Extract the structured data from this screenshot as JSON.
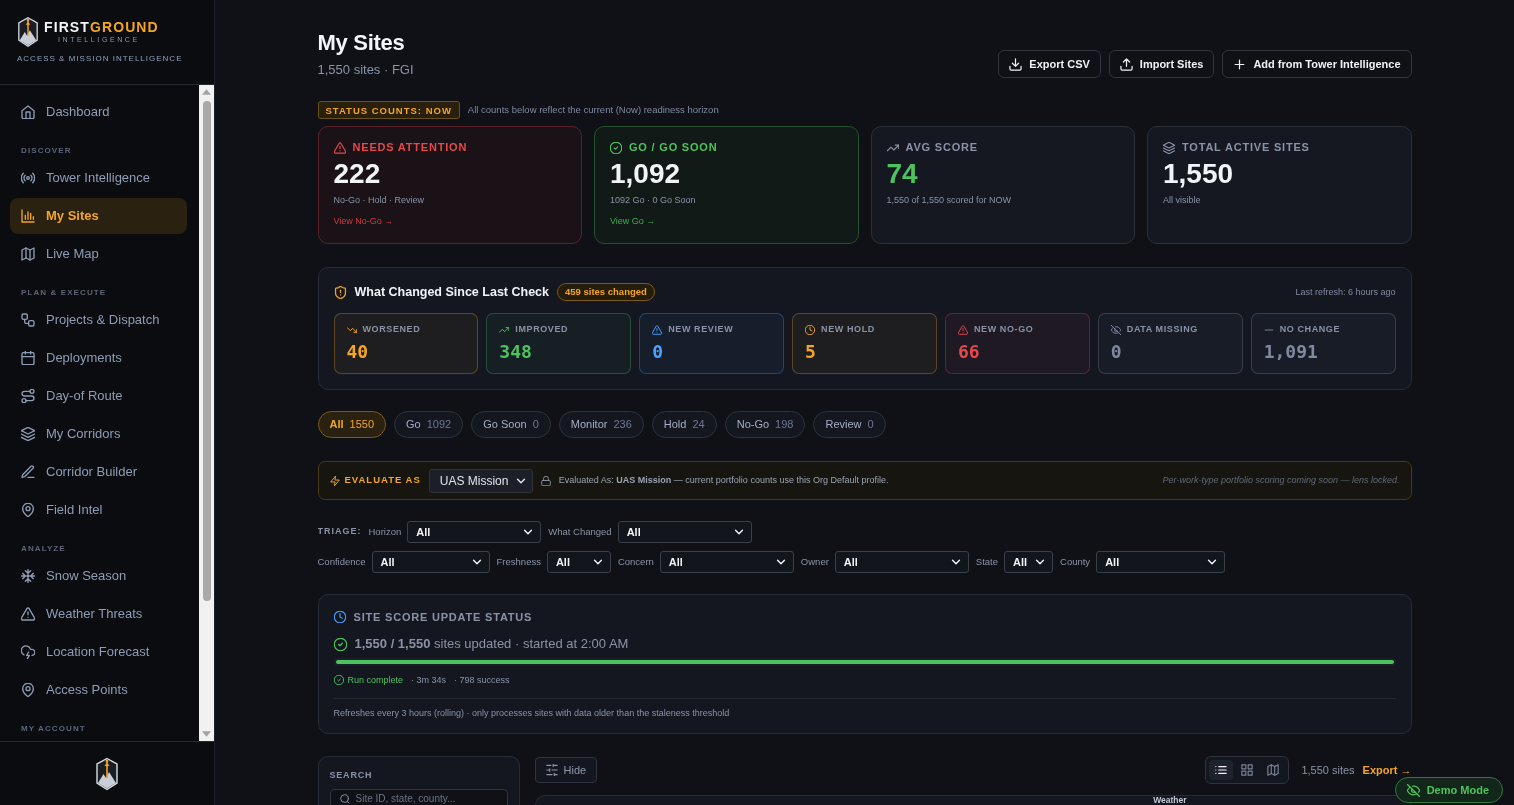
{
  "sidebar": {
    "brand": {
      "name_part_1": "FIRST",
      "name_part_2": "GROUND",
      "tagline": "INTELLIGENCE",
      "subtitle": "ACCESS & MISSION INTELLIGENCE"
    },
    "nav": [
      {
        "kind": "item",
        "label": "Dashboard",
        "selected": false
      },
      {
        "kind": "section",
        "label": "DISCOVER"
      },
      {
        "kind": "item",
        "label": "Tower Intelligence",
        "selected": false
      },
      {
        "kind": "item",
        "label": "My Sites",
        "selected": true
      },
      {
        "kind": "item",
        "label": "Live Map",
        "selected": false
      },
      {
        "kind": "section",
        "label": "PLAN & EXECUTE"
      },
      {
        "kind": "item",
        "label": "Projects & Dispatch",
        "selected": false
      },
      {
        "kind": "item",
        "label": "Deployments",
        "selected": false
      },
      {
        "kind": "item",
        "label": "Day-of Route",
        "selected": false
      },
      {
        "kind": "item",
        "label": "My Corridors",
        "selected": false
      },
      {
        "kind": "item",
        "label": "Corridor Builder",
        "selected": false
      },
      {
        "kind": "item",
        "label": "Field Intel",
        "selected": false
      },
      {
        "kind": "section",
        "label": "ANALYZE"
      },
      {
        "kind": "item",
        "label": "Snow Season",
        "selected": false
      },
      {
        "kind": "item",
        "label": "Weather Threats",
        "selected": false
      },
      {
        "kind": "item",
        "label": "Location Forecast",
        "selected": false
      },
      {
        "kind": "item",
        "label": "Access Points",
        "selected": false
      },
      {
        "kind": "section",
        "label": "MY ACCOUNT"
      }
    ]
  },
  "header": {
    "title": "My Sites",
    "subtitle": "1,550 sites · FGI",
    "actions": [
      "Export CSV",
      "Import Sites",
      "Add from Tower Intelligence"
    ]
  },
  "status_badge": "STATUS COUNTS: NOW",
  "status_note": "All counts below reflect the current (Now) readiness horizon",
  "stat_cards": [
    {
      "kind": "alert",
      "label": "NEEDS ATTENTION",
      "value": "222",
      "detail": "No-Go · Hold · Review",
      "link": "View No-Go →"
    },
    {
      "kind": "go",
      "label": "GO / GO SOON",
      "value": "1,092",
      "detail": "1092 Go · 0 Go Soon",
      "link": "View Go →"
    },
    {
      "kind": "score",
      "label": "AVG SCORE",
      "value": "74",
      "detail": "1,550 of 1,550 scored for NOW"
    },
    {
      "kind": "total",
      "label": "TOTAL ACTIVE SITES",
      "value": "1,550",
      "detail": "All visible"
    }
  ],
  "changes": {
    "title": "What Changed Since Last Check",
    "badge": "459 sites changed",
    "refresh": "Last refresh: 6 hours ago",
    "tiles": [
      {
        "color": "#f5a524",
        "label": "WORSENED",
        "value": "40"
      },
      {
        "color": "#4cc35e",
        "label": "IMPROVED",
        "value": "348"
      },
      {
        "color": "#4aa3ff",
        "label": "NEW REVIEW",
        "value": "0"
      },
      {
        "color": "#f5a524",
        "label": "NEW HOLD",
        "value": "5"
      },
      {
        "color": "#e5484d",
        "label": "NEW NO-GO",
        "value": "66"
      },
      {
        "color": "#7f8aa0",
        "label": "DATA MISSING",
        "value": "0"
      },
      {
        "color": "#7f8aa0",
        "label": "NO CHANGE",
        "value": "1,091"
      }
    ]
  },
  "filter_chips": [
    {
      "label": "All",
      "count": "1550",
      "selected": true
    },
    {
      "label": "Go",
      "count": "1092",
      "selected": false
    },
    {
      "label": "Go Soon",
      "count": "0",
      "selected": false
    },
    {
      "label": "Monitor",
      "count": "236",
      "selected": false
    },
    {
      "label": "Hold",
      "count": "24",
      "selected": false
    },
    {
      "label": "No-Go",
      "count": "198",
      "selected": false
    },
    {
      "label": "Review",
      "count": "0",
      "selected": false
    }
  ],
  "evaluate": {
    "label": "EVALUATE AS",
    "profile": "UAS Mission",
    "note": "Evaluated As: **UAS Mission** — current portfolio counts use this Org Default profile.",
    "locked_note": "Per-work-type portfolio scoring coming soon — lens locked."
  },
  "triage": {
    "label": "TRIAGE:",
    "filter_rows": [
      [
        {
          "label": "Horizon",
          "value": "All"
        },
        {
          "label": "What Changed",
          "value": "All"
        }
      ],
      [
        {
          "label": "Confidence",
          "value": "All"
        },
        {
          "label": "Freshness",
          "value": "All"
        },
        {
          "label": "Concern",
          "value": "All"
        },
        {
          "label": "Owner",
          "value": "All"
        },
        {
          "label": "State",
          "value": "All"
        },
        {
          "label": "County",
          "value": "All"
        }
      ]
    ]
  },
  "score_status": {
    "title": "SITE SCORE UPDATE STATUS",
    "summary": "**1,550 / 1,550** sites updated · started at 2:00 AM",
    "level": 1,
    "run_state": "Run complete",
    "stats": [
      "· 3m 34s",
      "· 798 success"
    ],
    "footnote": "Refreshes every 3 hours (rolling) · only processes sites with data older than the staleness threshold"
  },
  "search": {
    "label": "SEARCH",
    "placeholder": "Site ID, state, county..."
  },
  "list_toolbar": {
    "hide_button": "Hide",
    "view_modes": [
      {
        "selected": true
      },
      {
        "selected": false
      },
      {
        "selected": false
      }
    ],
    "count": "1,550 sites",
    "export": "Export →"
  },
  "table": {
    "column_groups": [
      "Weather"
    ]
  },
  "demo_mode": "Demo Mode"
}
